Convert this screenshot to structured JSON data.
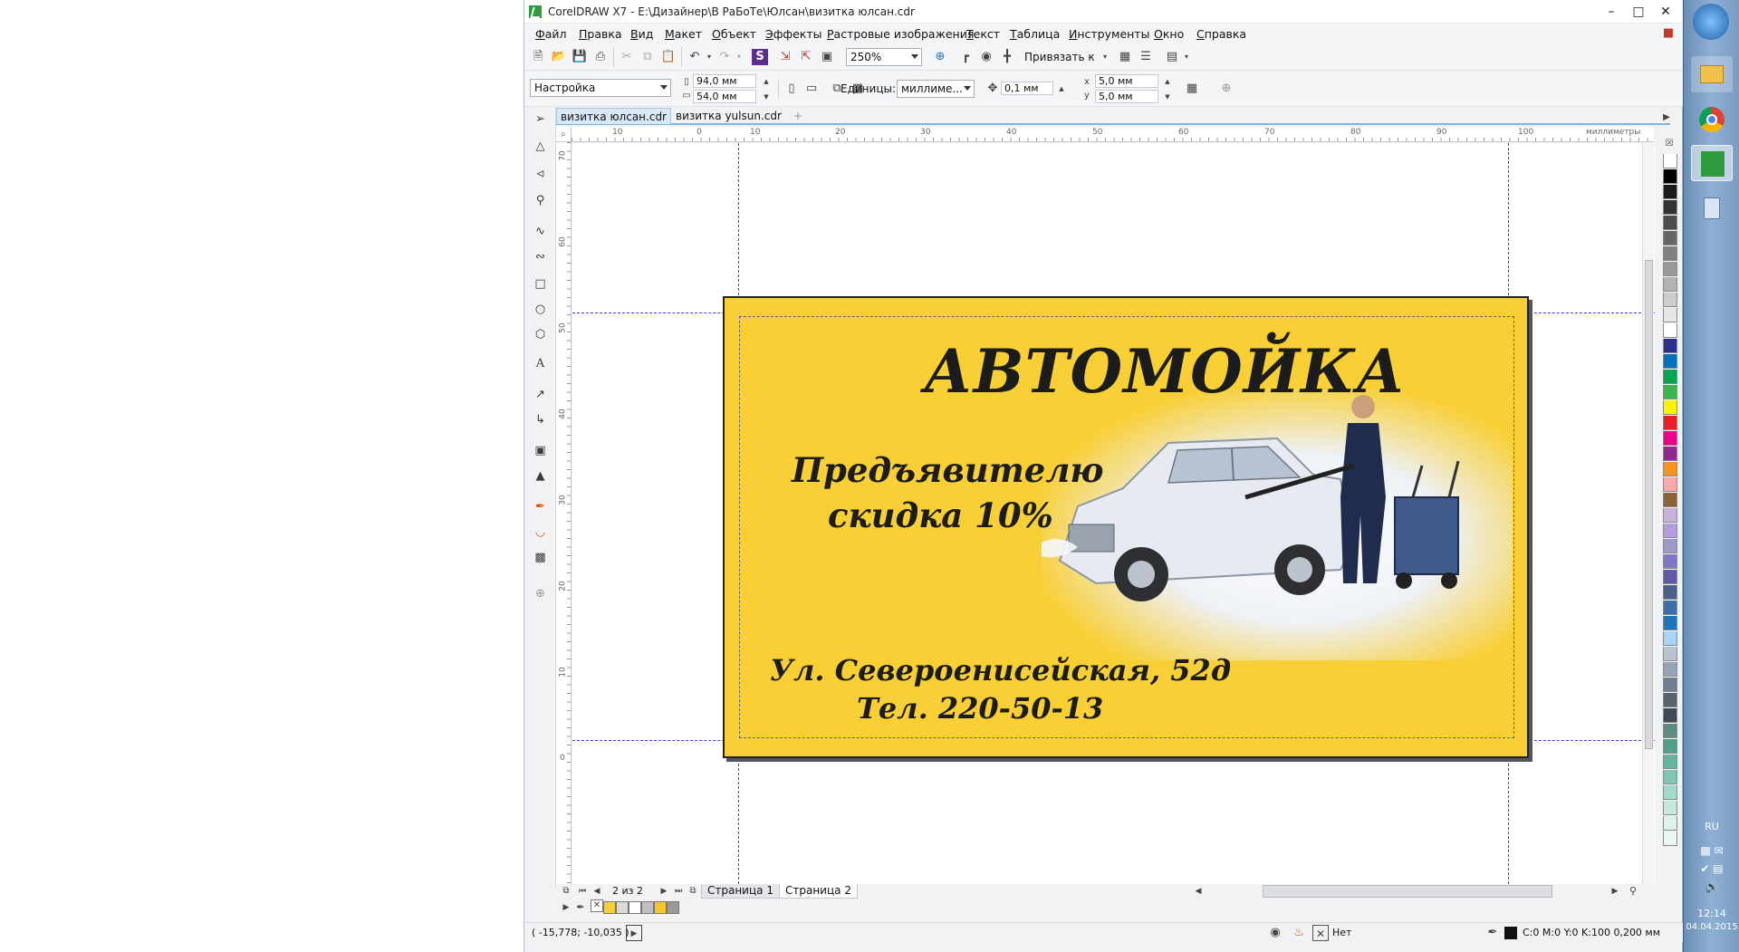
{
  "window": {
    "title": "CorelDRAW X7 - E:\\Дизайнер\\В РаБоТе\\Юлсан\\визитка юлсан.cdr"
  },
  "menu": [
    "Файл",
    "Правка",
    "Вид",
    "Макет",
    "Объект",
    "Эффекты",
    "Растровые изображения",
    "Текст",
    "Таблица",
    "Инструменты",
    "Окно",
    "Справка"
  ],
  "toolbar": {
    "zoom": "250%",
    "snap_label": "Привязать к"
  },
  "property_bar": {
    "preset": "Настройка",
    "width": "94,0 мм",
    "height": "54,0 мм",
    "units_label": "Единицы:",
    "units_value": "миллиме...",
    "nudge": "0,1 мм",
    "dup_x": "5,0 мм",
    "dup_y": "5,0 мм"
  },
  "tabs": [
    "визитка юлсан.cdr",
    "визитка yulsun.cdr"
  ],
  "ruler": {
    "unit_label": "миллиметры",
    "h_ticks": [
      "10",
      "0",
      "10",
      "20",
      "30",
      "40",
      "50",
      "60",
      "70",
      "80",
      "90",
      "100"
    ],
    "v_ticks": [
      "70",
      "60",
      "50",
      "40",
      "30",
      "20",
      "10",
      "0"
    ]
  },
  "card": {
    "title": "АВТОМОЙКА",
    "offer_line1": "Предъявителю",
    "offer_line2": "скидка 10%",
    "address": "Ул. Североенисейская, 52д",
    "phone": "Тел. 220-50-13",
    "background_color": "#f8cf35"
  },
  "pages": {
    "counter": "2 из 2",
    "tab1": "Страница 1",
    "tab2": "Страница 2"
  },
  "status": {
    "coords": "( -15,778; -10,035 )",
    "fill_none": "Нет",
    "outline": "C:0 M:0 Y:0 K:100  0,200 мм"
  },
  "taskbar": {
    "lang": "RU",
    "time": "12:14",
    "date": "04.04.2015"
  },
  "palette_colors": [
    "#ffffff",
    "#000000",
    "#1a1a1a",
    "#333333",
    "#4d4d4d",
    "#666666",
    "#808080",
    "#999999",
    "#b3b3b3",
    "#cccccc",
    "#e6e6e6",
    "#ffffff",
    "#2e3192",
    "#0071bc",
    "#00a651",
    "#39b54a",
    "#fff200",
    "#ed1c24",
    "#ec008c",
    "#92278f",
    "#f7941d",
    "#f9a7a7",
    "#8c6239",
    "#c7b2de",
    "#b39ddb",
    "#9e9ac8",
    "#7e78c8",
    "#5e5aa8",
    "#4a5f8a",
    "#3c6fa8",
    "#1b75bc",
    "#a9d4f5",
    "#b8c4d0",
    "#95a5b5",
    "#6d7f91",
    "#56626e",
    "#3e4a56",
    "#5c8c80",
    "#4fa08a",
    "#66b3a0",
    "#7fc7b5",
    "#a3d9cb",
    "#c8e8dd",
    "#dff2ea",
    "#eaf7f0"
  ]
}
